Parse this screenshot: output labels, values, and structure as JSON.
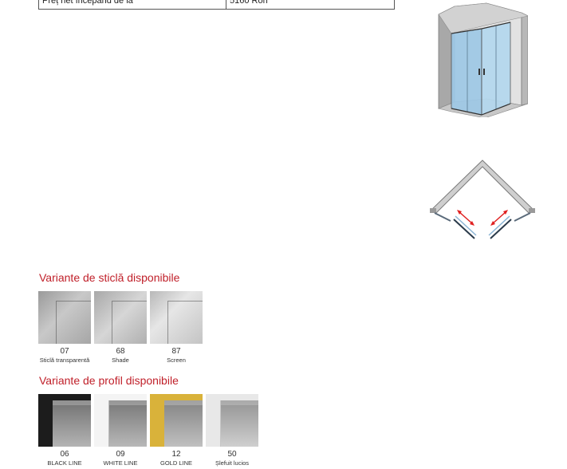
{
  "price_table": {
    "label": "Preț net începând de la",
    "value": "5160 Ron"
  },
  "glass_section": {
    "title": "Variante de sticlă disponibile",
    "items": [
      {
        "code": "07",
        "label": "Sticlă transparentă"
      },
      {
        "code": "68",
        "label": "Shade"
      },
      {
        "code": "87",
        "label": "Screen"
      }
    ]
  },
  "profile_section": {
    "title": "Variante de profil disponibile",
    "items": [
      {
        "code": "06",
        "label": "BLACK LINE",
        "color": "#1c1c1c"
      },
      {
        "code": "09",
        "label": "WHITE LINE",
        "color": "#f4f4f4"
      },
      {
        "code": "12",
        "label": "GOLD LINE",
        "color": "#d9b23a"
      },
      {
        "code": "50",
        "label": "Șlefuit lucios",
        "color": "#e8e8e8"
      }
    ]
  },
  "colors": {
    "heading": "#c0202a",
    "arrow": "#e02020",
    "glass_panel": "#9ec8e6"
  }
}
